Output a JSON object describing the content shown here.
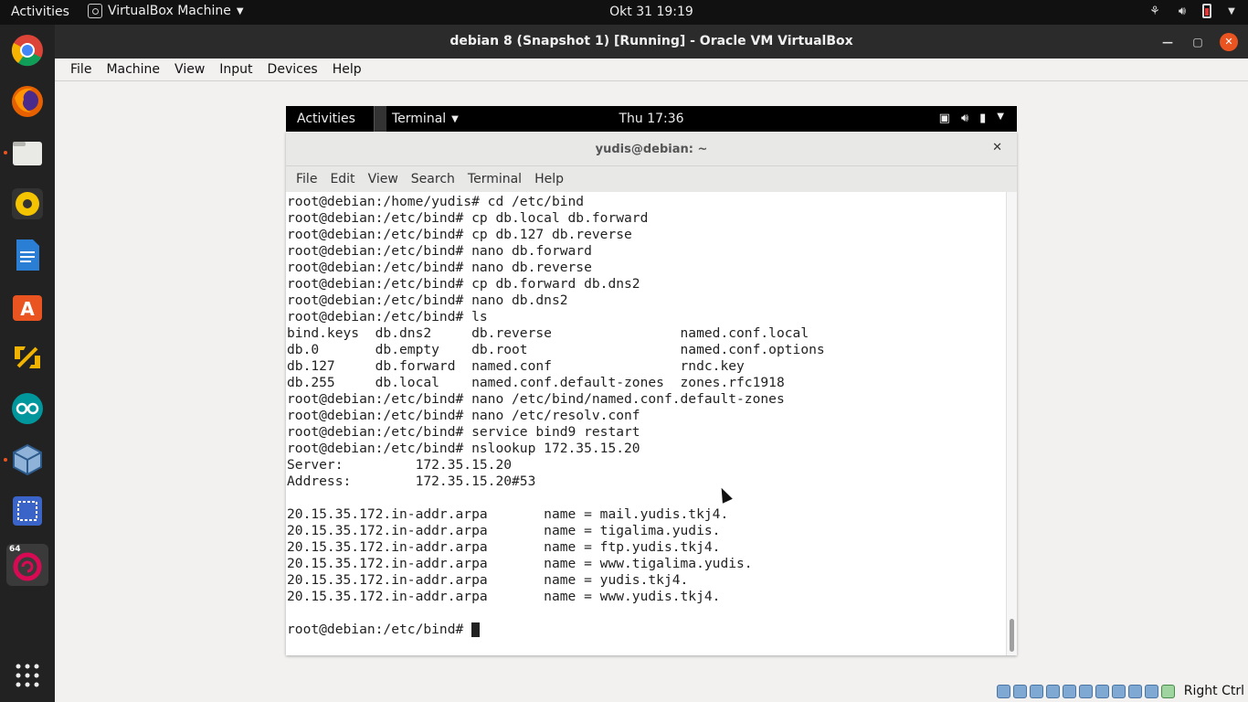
{
  "host_topbar": {
    "activities": "Activities",
    "app_name": "VirtualBox Machine",
    "clock": "Okt 31  19:19"
  },
  "dock": {
    "apps": [
      "chrome-icon",
      "firefox-icon",
      "files-icon",
      "rhythmbox-icon",
      "libreoffice-writer-icon",
      "software-center-icon",
      "transfer-icon",
      "arduino-icon",
      "virtualbox-icon",
      "screenshot-icon",
      "debian-vm-icon"
    ],
    "badge_64": "64"
  },
  "vbox": {
    "title": "debian 8 (Snapshot 1) [Running] - Oracle VM VirtualBox",
    "menu": [
      "File",
      "Machine",
      "View",
      "Input",
      "Devices",
      "Help"
    ],
    "host_key": "Right Ctrl"
  },
  "guest_topbar": {
    "activities": "Activities",
    "app": "Terminal",
    "clock": "Thu 17:36"
  },
  "terminal": {
    "title": "yudis@debian: ~",
    "menu": [
      "File",
      "Edit",
      "View",
      "Search",
      "Terminal",
      "Help"
    ],
    "lines": [
      "root@debian:/home/yudis# cd /etc/bind",
      "root@debian:/etc/bind# cp db.local db.forward",
      "root@debian:/etc/bind# cp db.127 db.reverse",
      "root@debian:/etc/bind# nano db.forward",
      "root@debian:/etc/bind# nano db.reverse",
      "root@debian:/etc/bind# cp db.forward db.dns2",
      "root@debian:/etc/bind# nano db.dns2",
      "root@debian:/etc/bind# ls",
      "bind.keys  db.dns2     db.reverse                named.conf.local",
      "db.0       db.empty    db.root                   named.conf.options",
      "db.127     db.forward  named.conf                rndc.key",
      "db.255     db.local    named.conf.default-zones  zones.rfc1918",
      "root@debian:/etc/bind# nano /etc/bind/named.conf.default-zones",
      "root@debian:/etc/bind# nano /etc/resolv.conf",
      "root@debian:/etc/bind# service bind9 restart",
      "root@debian:/etc/bind# nslookup 172.35.15.20",
      "Server:         172.35.15.20",
      "Address:        172.35.15.20#53",
      "",
      "20.15.35.172.in-addr.arpa       name = mail.yudis.tkj4.",
      "20.15.35.172.in-addr.arpa       name = tigalima.yudis.",
      "20.15.35.172.in-addr.arpa       name = ftp.yudis.tkj4.",
      "20.15.35.172.in-addr.arpa       name = www.tigalima.yudis.",
      "20.15.35.172.in-addr.arpa       name = yudis.tkj4.",
      "20.15.35.172.in-addr.arpa       name = www.yudis.tkj4.",
      ""
    ],
    "prompt": "root@debian:/etc/bind# "
  }
}
